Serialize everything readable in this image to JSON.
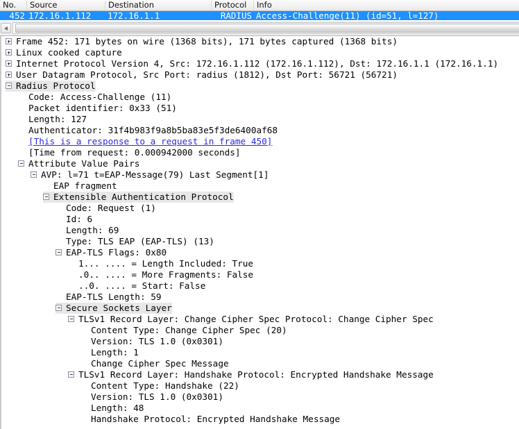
{
  "packet_list": {
    "columns": [
      {
        "name": "no",
        "label": "No."
      },
      {
        "name": "source",
        "label": "Source"
      },
      {
        "name": "destination",
        "label": "Destination"
      },
      {
        "name": "protocol",
        "label": "Protocol"
      },
      {
        "name": "info",
        "label": "Info"
      }
    ],
    "selected_row": {
      "no": "452",
      "source": "172.16.1.112",
      "destination": "172.16.1.1",
      "protocol": "RADIUS",
      "info": "Access-Challenge(11)  (id=51, l=127)"
    },
    "selection_color": "#1e90ff",
    "selection_text_color": "#ffffff"
  },
  "scrollbar": {
    "left_arrow_icon": "triangle-left-icon",
    "orientation": "horizontal"
  },
  "detail_tree": {
    "protocol_row_background": "#e8e8e8",
    "link_color": "#2b2bdd",
    "rows": [
      {
        "indent": 0,
        "expander": "plus",
        "text": "Frame 452: 171 bytes on wire (1368 bits), 171 bytes captured (1368 bits)",
        "style": "normal",
        "name": "tree-row-frame"
      },
      {
        "indent": 0,
        "expander": "plus",
        "text": "Linux cooked capture",
        "style": "normal",
        "name": "tree-row-linux-cooked-capture"
      },
      {
        "indent": 0,
        "expander": "plus",
        "text": "Internet Protocol Version 4, Src: 172.16.1.112 (172.16.1.112), Dst: 172.16.1.1 (172.16.1.1)",
        "style": "normal",
        "name": "tree-row-ipv4"
      },
      {
        "indent": 0,
        "expander": "plus",
        "text": "User Datagram Protocol, Src Port: radius (1812), Dst Port: 56721 (56721)",
        "style": "normal",
        "name": "tree-row-udp"
      },
      {
        "indent": 0,
        "expander": "minus",
        "text": "Radius Protocol",
        "style": "protocol",
        "name": "tree-row-radius-protocol"
      },
      {
        "indent": 1,
        "expander": "none",
        "text": "Code: Access-Challenge (11)",
        "style": "normal",
        "name": "tree-row-radius-code"
      },
      {
        "indent": 1,
        "expander": "none",
        "text": "Packet identifier: 0x33 (51)",
        "style": "normal",
        "name": "tree-row-packet-identifier"
      },
      {
        "indent": 1,
        "expander": "none",
        "text": "Length: 127",
        "style": "normal",
        "name": "tree-row-radius-length"
      },
      {
        "indent": 1,
        "expander": "none",
        "text": "Authenticator: 31f4b983f9a8b5ba83e5f3de6400af68",
        "style": "normal",
        "name": "tree-row-authenticator"
      },
      {
        "indent": 1,
        "expander": "none",
        "text": "[This is a response to a request in frame 450]",
        "style": "link",
        "name": "tree-row-response-to-request-link"
      },
      {
        "indent": 1,
        "expander": "none",
        "text": "[Time from request: 0.000942000 seconds]",
        "style": "normal",
        "name": "tree-row-time-from-request"
      },
      {
        "indent": 1,
        "expander": "minus",
        "text": "Attribute Value Pairs",
        "style": "normal",
        "name": "tree-row-attribute-value-pairs"
      },
      {
        "indent": 2,
        "expander": "minus",
        "text": "AVP: l=71  t=EAP-Message(79) Last Segment[1]",
        "style": "normal",
        "name": "tree-row-avp-eap-message"
      },
      {
        "indent": 3,
        "expander": "none",
        "text": "EAP fragment",
        "style": "normal",
        "name": "tree-row-eap-fragment"
      },
      {
        "indent": 3,
        "expander": "minus",
        "text": "Extensible Authentication Protocol",
        "style": "protocol",
        "name": "tree-row-extensible-authentication-protocol"
      },
      {
        "indent": 4,
        "expander": "none",
        "text": "Code: Request (1)",
        "style": "normal",
        "name": "tree-row-eap-code"
      },
      {
        "indent": 4,
        "expander": "none",
        "text": "Id: 6",
        "style": "normal",
        "name": "tree-row-eap-id"
      },
      {
        "indent": 4,
        "expander": "none",
        "text": "Length: 69",
        "style": "normal",
        "name": "tree-row-eap-length"
      },
      {
        "indent": 4,
        "expander": "none",
        "text": "Type: TLS EAP (EAP-TLS) (13)",
        "style": "normal",
        "name": "tree-row-eap-type"
      },
      {
        "indent": 4,
        "expander": "minus",
        "text": "EAP-TLS Flags: 0x80",
        "style": "normal",
        "name": "tree-row-eap-tls-flags"
      },
      {
        "indent": 5,
        "expander": "none",
        "text": "1... .... = Length Included: True",
        "style": "normal",
        "name": "tree-row-flag-length-included"
      },
      {
        "indent": 5,
        "expander": "none",
        "text": ".0.. .... = More Fragments: False",
        "style": "normal",
        "name": "tree-row-flag-more-fragments"
      },
      {
        "indent": 5,
        "expander": "none",
        "text": "..0. .... = Start: False",
        "style": "normal",
        "name": "tree-row-flag-start"
      },
      {
        "indent": 4,
        "expander": "none",
        "text": "EAP-TLS Length: 59",
        "style": "normal",
        "name": "tree-row-eap-tls-length"
      },
      {
        "indent": 4,
        "expander": "minus",
        "text": "Secure Sockets Layer",
        "style": "protocol",
        "name": "tree-row-secure-sockets-layer"
      },
      {
        "indent": 5,
        "expander": "minus",
        "text": "TLSv1 Record Layer: Change Cipher Spec Protocol: Change Cipher Spec",
        "style": "normal",
        "name": "tree-row-tls-record-change-cipher-spec"
      },
      {
        "indent": 6,
        "expander": "none",
        "text": "Content Type: Change Cipher Spec (20)",
        "style": "normal",
        "name": "tree-row-ccs-content-type"
      },
      {
        "indent": 6,
        "expander": "none",
        "text": "Version: TLS 1.0 (0x0301)",
        "style": "normal",
        "name": "tree-row-ccs-version"
      },
      {
        "indent": 6,
        "expander": "none",
        "text": "Length: 1",
        "style": "normal",
        "name": "tree-row-ccs-length"
      },
      {
        "indent": 6,
        "expander": "none",
        "text": "Change Cipher Spec Message",
        "style": "normal",
        "name": "tree-row-ccs-message"
      },
      {
        "indent": 5,
        "expander": "minus",
        "text": "TLSv1 Record Layer: Handshake Protocol: Encrypted Handshake Message",
        "style": "normal",
        "name": "tree-row-tls-record-handshake"
      },
      {
        "indent": 6,
        "expander": "none",
        "text": "Content Type: Handshake (22)",
        "style": "normal",
        "name": "tree-row-hs-content-type"
      },
      {
        "indent": 6,
        "expander": "none",
        "text": "Version: TLS 1.0 (0x0301)",
        "style": "normal",
        "name": "tree-row-hs-version"
      },
      {
        "indent": 6,
        "expander": "none",
        "text": "Length: 48",
        "style": "normal",
        "name": "tree-row-hs-length"
      },
      {
        "indent": 6,
        "expander": "none",
        "text": "Handshake Protocol: Encrypted Handshake Message",
        "style": "normal",
        "name": "tree-row-hs-protocol-message"
      }
    ]
  }
}
